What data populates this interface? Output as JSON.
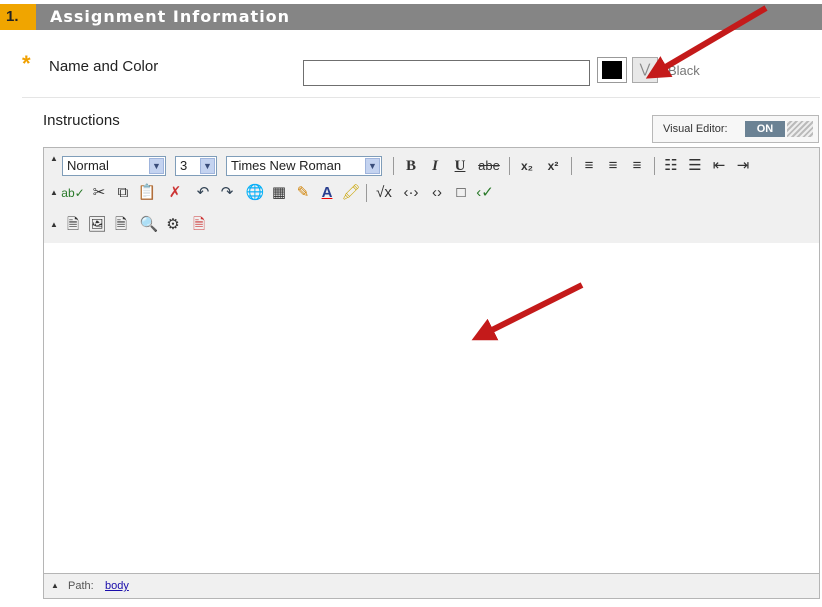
{
  "header": {
    "step_number": "1.",
    "title": "Assignment Information"
  },
  "name_field": {
    "required_marker": "*",
    "label": "Name and Color",
    "value": "",
    "placeholder": "",
    "color_name": "Black",
    "swatch_color": "#000000"
  },
  "instructions": {
    "label": "Instructions"
  },
  "visual_editor": {
    "label": "Visual Editor:",
    "state": "ON"
  },
  "toolbar": {
    "format_select": "Normal",
    "size_select": "3",
    "font_select": "Times New Roman",
    "bold": "B",
    "italic": "I",
    "underline": "U",
    "strike": "abe",
    "subscript": "x₂",
    "superscript": "x²"
  },
  "pathbar": {
    "label": "Path:",
    "link": "body"
  },
  "colors": {
    "header_bar": "#858585",
    "step_badge": "#f0a500",
    "required_star": "#f0a000",
    "arrow": "#c41a1a"
  }
}
